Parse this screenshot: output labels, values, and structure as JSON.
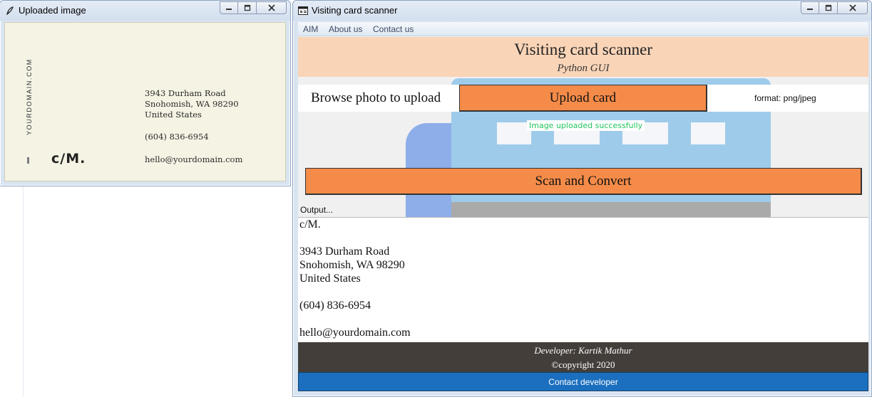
{
  "image_window": {
    "title": "Uploaded image",
    "icon": "feather-icon",
    "card": {
      "vertical_text": "YOURDOMAIN.COM",
      "logo": "c/M.",
      "address_lines": [
        "3943 Durham Road",
        "Snohomish, WA 98290",
        "United States"
      ],
      "phone": "(604) 836-6954",
      "email": "hello@yourdomain.com"
    }
  },
  "scanner_window": {
    "title": "Visiting card scanner",
    "icon": "app-window-icon",
    "menu": [
      "AIM",
      "About us",
      "Contact us"
    ],
    "header": {
      "title": "Visiting card scanner",
      "subtitle": "Python GUI"
    },
    "browse_label": "Browse photo to upload",
    "upload_button": "Upload card",
    "format_label": "format: png/jpeg",
    "success_message": "Image uploaded successfully",
    "scan_button": "Scan and Convert",
    "output_label": "Output...",
    "output_lines": [
      "c/M.",
      "",
      "3943 Durham Road",
      "Snohomish, WA 98290",
      "United States",
      "",
      "(604) 836-6954",
      "",
      "hello@yourdomain.com"
    ],
    "footer": {
      "developer": "Developer: Kartik Mathur",
      "copyright": "©copyright 2020"
    },
    "contact_button": "Contact developer"
  },
  "colors": {
    "header_bg": "#f9d4b7",
    "button_orange": "#f48b49",
    "success_green": "#22c55e",
    "footer_bg": "#433e3a",
    "contact_blue": "#1b6fbe"
  }
}
